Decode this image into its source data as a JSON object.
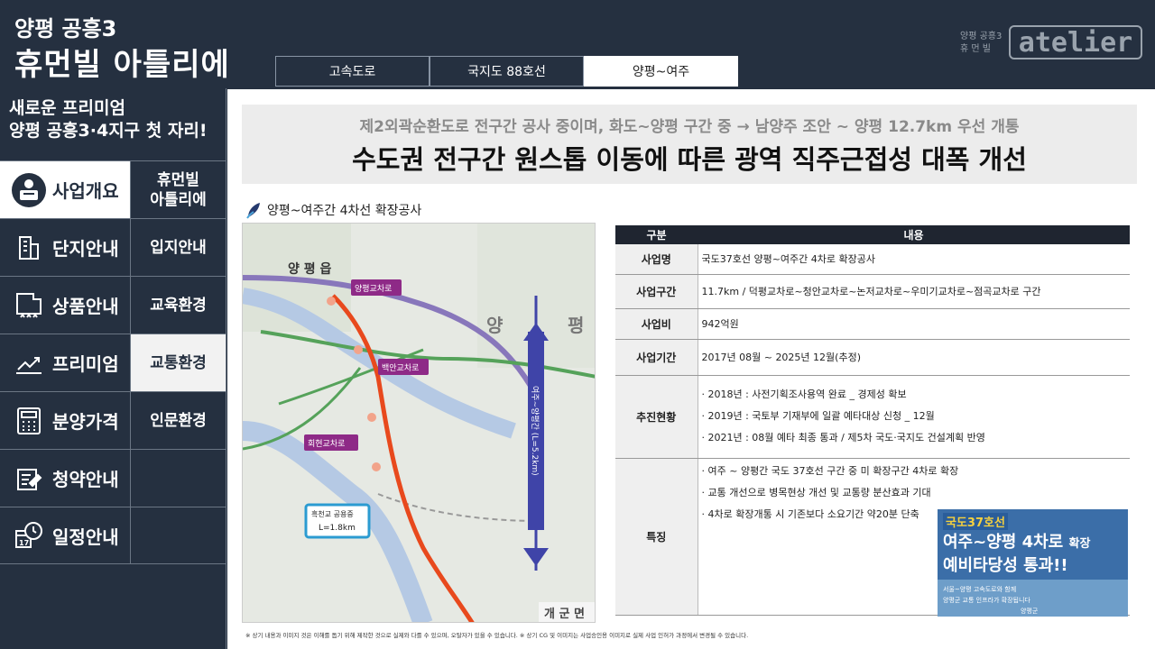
{
  "brand": {
    "subtitle": "양평 공흥3",
    "title": "휴먼빌 아틀리에"
  },
  "tabs": [
    {
      "label": "고속도로",
      "active": false
    },
    {
      "label": "국지도 88호선",
      "active": false
    },
    {
      "label": "양평~여주",
      "active": true
    }
  ],
  "logo": {
    "small_line1": "양평 공흥3",
    "small_line2": "휴 먼 빌",
    "text": "atelier"
  },
  "sidebar": {
    "tagline_line1": "새로운 프리미엄",
    "tagline_line2": "양평 공흥3·4지구 첫 자리!",
    "menu": [
      {
        "label": "사업개요",
        "icon": "business-overview-icon",
        "active": true,
        "sub": "휴먼빌\n아틀리에",
        "sub_active": false
      },
      {
        "label": "단지안내",
        "icon": "building-icon",
        "active": false,
        "sub": "입지안내",
        "sub_active": false
      },
      {
        "label": "상품안내",
        "icon": "floorplan-icon",
        "active": false,
        "sub": "교육환경",
        "sub_active": false
      },
      {
        "label": "프리미엄",
        "icon": "chart-up-icon",
        "active": false,
        "sub": "교통환경",
        "sub_active": true
      },
      {
        "label": "분양가격",
        "icon": "calculator-icon",
        "active": false,
        "sub": "인문환경",
        "sub_active": false
      },
      {
        "label": "청약안내",
        "icon": "edit-icon",
        "active": false,
        "sub": "",
        "sub_active": false
      },
      {
        "label": "일정안내",
        "icon": "calendar-clock-icon",
        "active": false,
        "sub": "",
        "sub_active": false
      }
    ]
  },
  "banner": {
    "subtitle": "제2외곽순환도로 전구간 공사 중이며, 화도~양평 구간 중 → 남양주 조안 ~ 양평 12.7km 우선 개통",
    "title": "수도권 전구간 원스톱 이동에 따른 광역 직주근접성 대폭 개선"
  },
  "section_title": "양평~여주간 4차선 확장공사",
  "map": {
    "labels": {
      "town_yangpyeong": "양 평 읍",
      "ic1": "양평교차로",
      "ic2": "백안교차로",
      "ic3": "회현교차로",
      "bridge_name": "흑천교 공용중",
      "bridge_len": "L=1.8km",
      "distance": "여주~양평간 (L=5.2km)",
      "area_yang": "양",
      "area_pyeong": "평",
      "village": "개 군 면"
    }
  },
  "table": {
    "headers": [
      "구분",
      "내용"
    ],
    "rows": [
      {
        "key": "사업명",
        "value": "국도37호선 양평~여주간 4차로 확장공사"
      },
      {
        "key": "사업구간",
        "value": "11.7km / 덕평교차로~청안교차로~논저교차로~우미기교차로~점곡교차로 구간"
      },
      {
        "key": "사업비",
        "value": "942억원"
      },
      {
        "key": "사업기간",
        "value": "2017년 08월 ~ 2025년 12월(추정)"
      }
    ],
    "progress_key": "추진현황",
    "progress_items": [
      "· 2018년 : 사전기획조사용역 완료 _ 경제성 확보",
      "· 2019년 : 국토부 기재부에 일괄 예타대상 신청 _ 12월",
      "· 2021년 : 08월 예타 최종 통과 / 제5차 국도·국지도 건설계획 반영"
    ],
    "feature_key": "특징",
    "feature_items": [
      "· 여주 ~ 양평간 국도 37호선 구간 중 미 확장구간 4차로 확장",
      "· 교통 개선으로 병목현상 개선 및 교통량 분산효과 기대",
      "· 4차로 확장개통 시 기존보다 소요기간 약20분 단축"
    ]
  },
  "promo": {
    "line1": "국도37호선",
    "line2": "여주~양평 4차로",
    "line2_suffix": "확장",
    "line3": "예비타당성 통과!!",
    "caption1": "서울~양평 고속도로와 함께",
    "caption2": "양평군 교통 인프라가 확장됩니다",
    "org": "양평군"
  },
  "footnote": "※ 상기 내용과 이미지 것은 이해를 돕기 위해 제작한 것으로 실제와 다를 수 있으며, 오탈자가 있을 수 있습니다. ※ 상기 CG 및 이미지는 사업승인용 이미지로 실제 사업 인허가 과정에서 변경될 수 있습니다."
}
